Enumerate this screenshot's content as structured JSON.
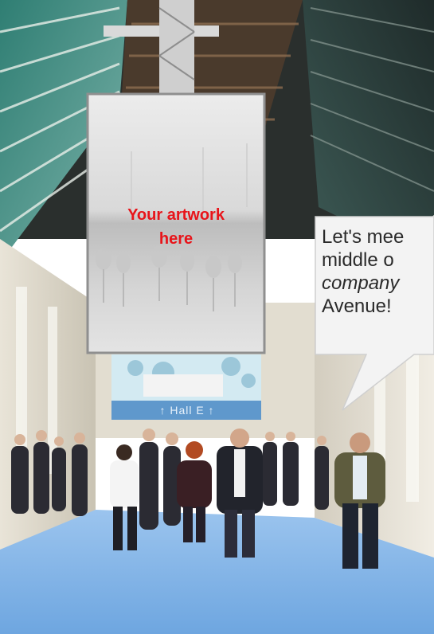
{
  "banner": {
    "line1": "Your artwork",
    "line2": "here"
  },
  "speech_bubble": {
    "line1": "Let's mee",
    "line2": "middle o",
    "line3": "company",
    "line4": "Avenue!"
  },
  "hall_sign": {
    "text": "↑   Hall E   ↑"
  },
  "colors": {
    "artwork_text": "#e8141a",
    "floor": "#7fb2e6",
    "roof_glass": "#3d8f82"
  }
}
